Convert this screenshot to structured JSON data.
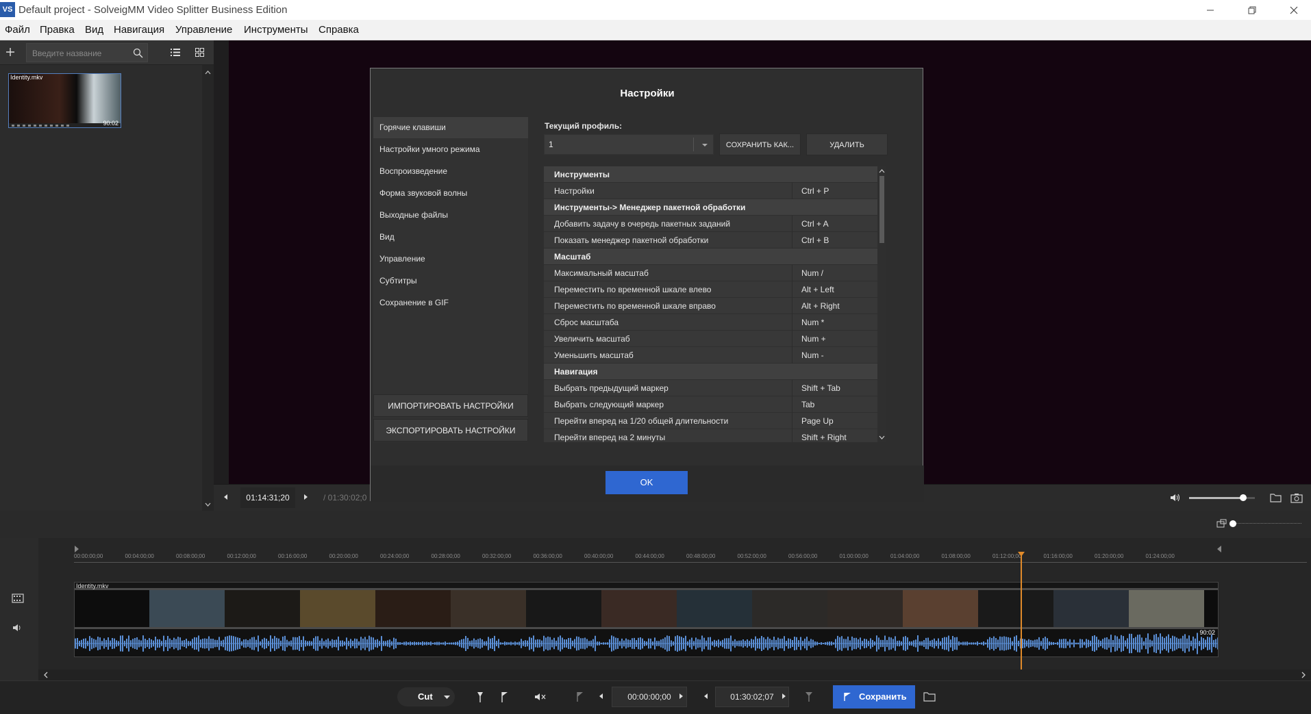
{
  "window": {
    "title": "Default project - SolveigMM Video Splitter Business Edition",
    "app_icon_text": "VS"
  },
  "menu": [
    "Файл",
    "Правка",
    "Вид",
    "Навигация",
    "Управление",
    "Инструменты",
    "Справка"
  ],
  "library": {
    "search_placeholder": "Введите название",
    "clip_name": "Identity.mkv",
    "clip_duration": "90:02"
  },
  "preview": {
    "current_time": "01:14:31;20",
    "total_time": "/ 01:30:02;0",
    "volume_fraction": 0.82
  },
  "dialog": {
    "title": "Настройки",
    "nav": [
      "Горячие клавиши",
      "Настройки умного режима",
      "Воспроизведение",
      "Форма звуковой волны",
      "Выходные файлы",
      "Вид",
      "Управление",
      "Субтитры",
      "Сохранение в GIF"
    ],
    "nav_active": 0,
    "import_label": "ИМПОРТИРОВАТЬ НАСТРОЙКИ",
    "export_label": "ЭКСПОРТИРОВАТЬ НАСТРОЙКИ",
    "profile_label": "Текущий профиль:",
    "profile_value": "1",
    "save_as_label": "СОХРАНИТЬ КАК...",
    "delete_label": "УДАЛИТЬ",
    "ok_label": "OK",
    "rows": [
      {
        "type": "group",
        "name": "Инструменты"
      },
      {
        "type": "item",
        "name": "Настройки",
        "key": "Ctrl + P"
      },
      {
        "type": "group",
        "name": "Инструменты-> Менеджер пакетной обработки"
      },
      {
        "type": "item",
        "name": "Добавить задачу в очередь пакетных заданий",
        "key": "Ctrl + A"
      },
      {
        "type": "item",
        "name": "Показать менеджер пакетной обработки",
        "key": "Ctrl + B"
      },
      {
        "type": "group",
        "name": "Масштаб"
      },
      {
        "type": "item",
        "name": "Максимальный масштаб",
        "key": "Num /"
      },
      {
        "type": "item",
        "name": "Переместить по временной шкале влево",
        "key": "Alt + Left"
      },
      {
        "type": "item",
        "name": "Переместить по временной шкале вправо",
        "key": "Alt + Right"
      },
      {
        "type": "item",
        "name": "Сброс масштаба",
        "key": "Num *"
      },
      {
        "type": "item",
        "name": "Увеличить масштаб",
        "key": "Num +"
      },
      {
        "type": "item",
        "name": "Уменьшить масштаб",
        "key": "Num -"
      },
      {
        "type": "group",
        "name": "Навигация"
      },
      {
        "type": "item",
        "name": "Выбрать предыдущий маркер",
        "key": "Shift + Tab"
      },
      {
        "type": "item",
        "name": "Выбрать следующий маркер",
        "key": "Tab"
      },
      {
        "type": "item",
        "name": "Перейти вперед на 1/20 общей длительности",
        "key": "Page Up"
      },
      {
        "type": "item",
        "name": "Перейти вперед на 2 минуты",
        "key": "Shift + Right"
      }
    ]
  },
  "timeline": {
    "ticks": [
      "00:00:00;00",
      "00:04:00;00",
      "00:08:00;00",
      "00:12:00;00",
      "00:16:00;00",
      "00:20:00;00",
      "00:24:00;00",
      "00:28:00;00",
      "00:32:00;00",
      "00:36:00;00",
      "00:40:00;00",
      "00:44:00;00",
      "00:48:00;00",
      "00:52:00;00",
      "00:56:00;00",
      "01:00:00;00",
      "01:04:00;00",
      "01:08:00;00",
      "01:12:00;00",
      "01:16:00;00",
      "01:20:00;00",
      "01:24:00;00"
    ],
    "clip_name": "Identity.mkv",
    "clip_duration": "90:02",
    "zoom_fraction": 0.0
  },
  "bottom": {
    "mode": "Cut",
    "start_time": "00:00:00;00",
    "end_time": "01:30:02;07",
    "save_label": "Сохранить"
  },
  "colors": {
    "accent": "#2f67d1",
    "playhead": "#e08a2a",
    "waveform": "#5b8fd6",
    "video_bg": "#140510"
  }
}
